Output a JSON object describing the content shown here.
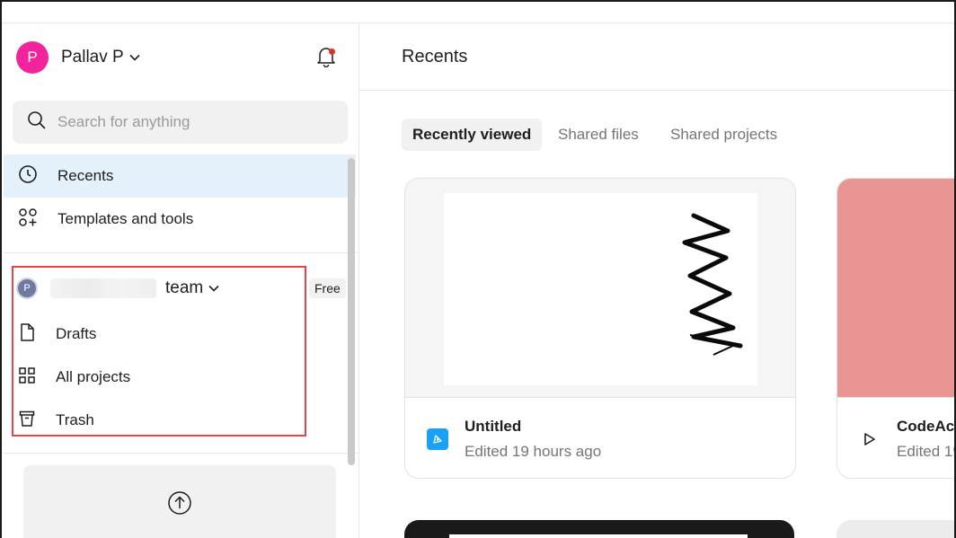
{
  "user": {
    "initial": "P",
    "name": "Pallav P"
  },
  "search": {
    "placeholder": "Search for anything"
  },
  "nav": {
    "recents": "Recents",
    "templates": "Templates and tools"
  },
  "team": {
    "initial": "P",
    "name_suffix": "team",
    "badge": "Free",
    "items": [
      "Drafts",
      "All projects",
      "Trash"
    ]
  },
  "main": {
    "title": "Recents",
    "tabs": [
      "Recently viewed",
      "Shared files",
      "Shared projects"
    ],
    "files": [
      {
        "title": "Untitled",
        "subtitle": "Edited 19 hours ago"
      },
      {
        "title": "CodeAca",
        "subtitle": "Edited 19"
      }
    ]
  },
  "colors": {
    "accent": "#18a0fb",
    "avatar": "#f2249b",
    "highlight_box": "#e04848",
    "selected_nav": "#e4f1fb",
    "card_thumbnail_2": "#e99594"
  }
}
